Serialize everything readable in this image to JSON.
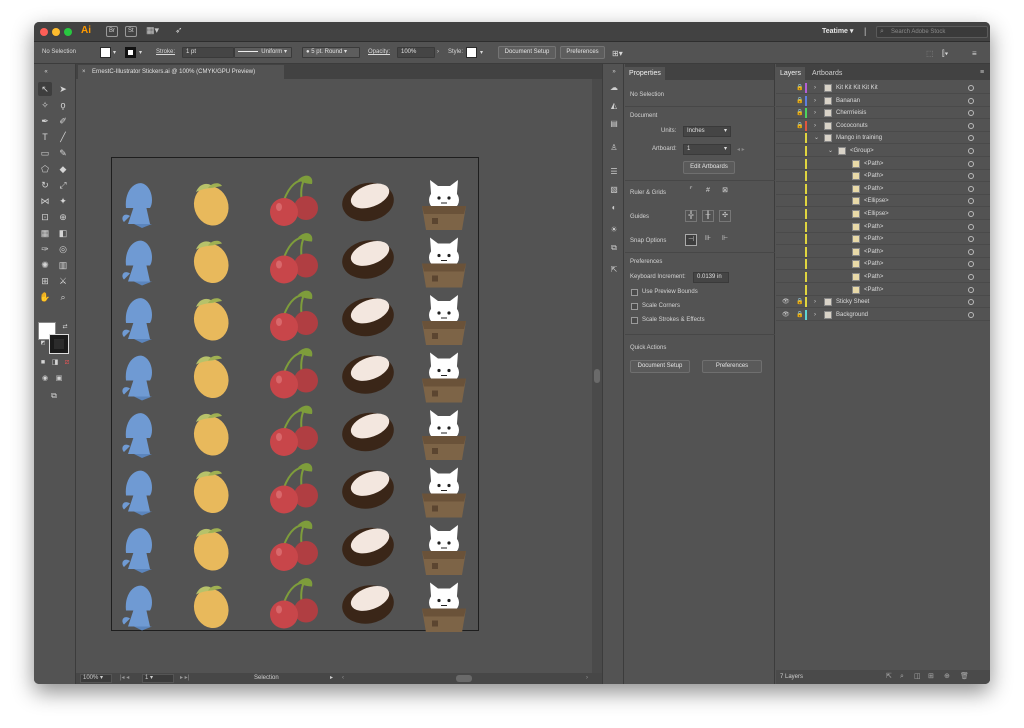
{
  "app": {
    "logo": "Ai",
    "bridge": "Br",
    "stock": "St",
    "workspace": "Teatime",
    "search_placeholder": "Search Adobe Stock"
  },
  "control": {
    "selection": "No Selection",
    "stroke_label": "Stroke:",
    "stroke_value": "1 pt",
    "profile": "Uniform",
    "brush": "5 pt. Round",
    "opacity_label": "Opacity:",
    "opacity_value": "100%",
    "style_label": "Style:",
    "document_setup": "Document Setup",
    "preferences": "Preferences"
  },
  "doc_tab": {
    "title": "ErnestC-Illustrator Stickers.ai @ 100% (CMYK/GPU Preview)",
    "close": "×"
  },
  "status": {
    "zoom": "100%",
    "artboard": "1",
    "tool": "Selection"
  },
  "properties": {
    "tab_properties": "Properties",
    "tab_layers": "Layers",
    "tab_artboards": "Artboards",
    "no_selection": "No Selection",
    "document": "Document",
    "units_label": "Units:",
    "units_value": "Inches",
    "artboard_label": "Artboard:",
    "artboard_value": "1",
    "edit_artboards": "Edit Artboards",
    "rulers_grids": "Ruler & Grids",
    "guides": "Guides",
    "snap_options": "Snap Options",
    "preferences": "Preferences",
    "keyboard_increment_label": "Keyboard Increment:",
    "keyboard_increment_value": "0.0139 in",
    "use_preview_bounds": "Use Preview Bounds",
    "scale_corners": "Scale Corners",
    "scale_strokes": "Scale Strokes & Effects",
    "quick_actions": "Quick Actions",
    "qa_document_setup": "Document Setup",
    "qa_preferences": "Preferences"
  },
  "layers": {
    "rows": [
      {
        "name": "Kit Kit Kit Kit Kit",
        "color": "#b35fd6",
        "level": 0,
        "twisty": "›",
        "eye": "",
        "lock": "🔒"
      },
      {
        "name": "Bananan",
        "color": "#5d7fe0",
        "level": 0,
        "twisty": "›",
        "eye": "",
        "lock": "🔒"
      },
      {
        "name": "Cherrrieisis",
        "color": "#4cd45e",
        "level": 0,
        "twisty": "›",
        "eye": "",
        "lock": "🔒"
      },
      {
        "name": "Cococonuts",
        "color": "#e0563f",
        "level": 0,
        "twisty": "›",
        "eye": "",
        "lock": "🔒"
      },
      {
        "name": "Mango in training",
        "color": "#e0d53f",
        "level": 0,
        "twisty": "⌄",
        "eye": "",
        "lock": ""
      },
      {
        "name": "<Group>",
        "color": "#e0d53f",
        "level": 1,
        "twisty": "⌄",
        "eye": "",
        "lock": ""
      },
      {
        "name": "<Path>",
        "color": "#e0d53f",
        "level": 2,
        "twisty": "",
        "eye": "",
        "lock": ""
      },
      {
        "name": "<Path>",
        "color": "#e0d53f",
        "level": 2,
        "twisty": "",
        "eye": "",
        "lock": ""
      },
      {
        "name": "<Path>",
        "color": "#e0d53f",
        "level": 2,
        "twisty": "",
        "eye": "",
        "lock": ""
      },
      {
        "name": "<Ellipse>",
        "color": "#e0d53f",
        "level": 2,
        "twisty": "",
        "eye": "",
        "lock": ""
      },
      {
        "name": "<Ellipse>",
        "color": "#e0d53f",
        "level": 2,
        "twisty": "",
        "eye": "",
        "lock": ""
      },
      {
        "name": "<Path>",
        "color": "#e0d53f",
        "level": 2,
        "twisty": "",
        "eye": "",
        "lock": ""
      },
      {
        "name": "<Path>",
        "color": "#e0d53f",
        "level": 2,
        "twisty": "",
        "eye": "",
        "lock": ""
      },
      {
        "name": "<Path>",
        "color": "#e0d53f",
        "level": 2,
        "twisty": "",
        "eye": "",
        "lock": ""
      },
      {
        "name": "<Path>",
        "color": "#e0d53f",
        "level": 2,
        "twisty": "",
        "eye": "",
        "lock": ""
      },
      {
        "name": "<Path>",
        "color": "#e0d53f",
        "level": 2,
        "twisty": "",
        "eye": "",
        "lock": ""
      },
      {
        "name": "<Path>",
        "color": "#e0d53f",
        "level": 2,
        "twisty": "",
        "eye": "",
        "lock": ""
      },
      {
        "name": "Sticky Sheet",
        "color": "#e0d53f",
        "level": 0,
        "twisty": "›",
        "eye": "👁",
        "lock": "🔒"
      },
      {
        "name": "Background",
        "color": "#5fd6d6",
        "level": 0,
        "twisty": "›",
        "eye": "👁",
        "lock": "🔒"
      }
    ],
    "count": "7 Layers"
  },
  "colors": {
    "mushroom": "#6f9ad3",
    "mango": "#e8b95c",
    "mango_leaf": "#b7c26a",
    "cherry": "#c8464a",
    "cherry_stem": "#7e9d3b",
    "coconut_shell": "#3a2618",
    "coconut_flesh": "#f3e7df",
    "cat_white": "#ffffff",
    "cat_basket": "#7d6447"
  }
}
